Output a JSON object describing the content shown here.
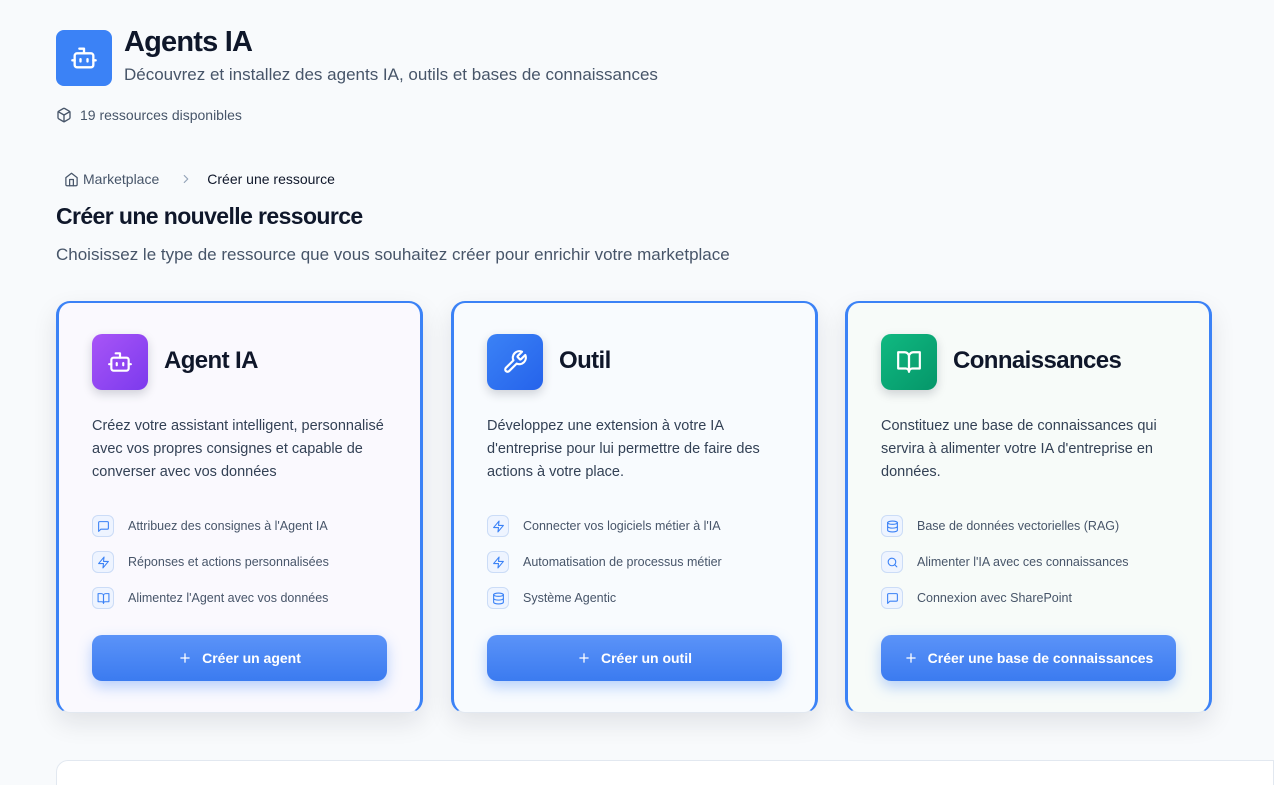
{
  "header": {
    "title": "Agents IA",
    "subtitle": "Découvrez et installez des agents IA, outils et bases de connaissances",
    "resource_count": "19 ressources disponibles",
    "logo_icon": "bot-icon",
    "accent_color": "#3b82f6"
  },
  "breadcrumb": {
    "home": "Marketplace",
    "current": "Créer une ressource"
  },
  "page": {
    "title": "Créer une nouvelle ressource",
    "subtitle": "Choisissez le type de ressource que vous souhaitez créer pour enrichir votre marketplace"
  },
  "cards": [
    {
      "title": "Agent IA",
      "icon": "bot-icon",
      "color": "#8b5cf6",
      "description": "Créez votre assistant intelligent, personnalisé avec vos propres consignes et capable de converser avec vos données",
      "features": [
        {
          "icon": "message-square-icon",
          "label": "Attribuez des consignes à l'Agent IA"
        },
        {
          "icon": "zap-icon",
          "label": "Réponses et actions personnalisées"
        },
        {
          "icon": "book-open-icon",
          "label": "Alimentez l'Agent avec vos données"
        }
      ],
      "button": "Créer un agent"
    },
    {
      "title": "Outil",
      "icon": "wrench-icon",
      "color": "#3b82f6",
      "description": "Développez une extension à votre IA d'entreprise pour lui permettre de faire des actions à votre place.",
      "features": [
        {
          "icon": "zap-icon",
          "label": "Connecter vos logiciels métier à l'IA"
        },
        {
          "icon": "zap-icon",
          "label": "Automatisation de processus métier"
        },
        {
          "icon": "database-icon",
          "label": "Système Agentic"
        }
      ],
      "button": "Créer un outil"
    },
    {
      "title": "Connaissances",
      "icon": "book-open-icon",
      "color": "#10b981",
      "description": "Constituez une base de connaissances qui servira à alimenter votre IA d'entreprise en données.",
      "features": [
        {
          "icon": "database-icon",
          "label": "Base de données vectorielles (RAG)"
        },
        {
          "icon": "search-icon",
          "label": "Alimenter l'IA avec ces connaissances"
        },
        {
          "icon": "message-square-icon",
          "label": "Connexion avec SharePoint"
        }
      ],
      "button": "Créer une base de connaissances"
    }
  ]
}
